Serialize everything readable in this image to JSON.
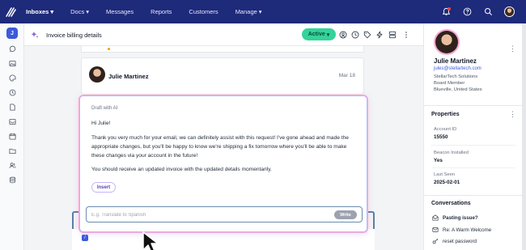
{
  "nav": {
    "items": [
      {
        "label": "Inboxes",
        "caret": true,
        "active": true
      },
      {
        "label": "Docs",
        "caret": true
      },
      {
        "label": "Messages",
        "caret": false
      },
      {
        "label": "Reports",
        "caret": false
      },
      {
        "label": "Customers",
        "caret": false
      },
      {
        "label": "Manage",
        "caret": true
      }
    ],
    "right_icons": [
      "notifications-icon",
      "help-icon",
      "search-icon",
      "user-avatar"
    ]
  },
  "leftbar": {
    "avatar_letter": "J",
    "icons": [
      "chat-icon",
      "image-icon",
      "palette-icon",
      "clock-icon",
      "document-icon",
      "inbox-icon",
      "calendar-icon",
      "folder-icon",
      "users-icon",
      "database-icon"
    ]
  },
  "header": {
    "title": "Invoice billing details",
    "status_label": "Active",
    "icons": [
      "assign-icon",
      "clock-icon",
      "tag-icon",
      "lightning-icon",
      "layout-icon",
      "more-icon"
    ]
  },
  "message": {
    "sender": "Julie Martinez",
    "date": "Mar 18"
  },
  "draft": {
    "label": "Draft with AI",
    "greeting": "Hi Julie!",
    "body": "Thank you very much for your email, we can definitely assist with this request! I've gone ahead and made the appropriate changes, but you'll be happy to know we're shipping a fix tomorrow where you'll be able to make these changes via your account in the future!",
    "closing": "You should receive an updated invoice with the updated details momentarily.",
    "insert_label": "Insert",
    "prompt_placeholder": "E.g. Translate to Spanish",
    "write_label": "Write"
  },
  "customer": {
    "name": "Julie Martinez",
    "email": "jules@stellartech.com",
    "company": "StellarTech Solutions",
    "role": "Board Member",
    "location": "Blueville, United States"
  },
  "properties": {
    "title": "Properties",
    "items": [
      {
        "label": "Account ID",
        "value": "15550"
      },
      {
        "label": "Beacon Installed",
        "value": "Yes"
      },
      {
        "label": "Last Seen",
        "value": "2025-02-01"
      }
    ]
  },
  "conversations": {
    "title": "Conversations",
    "items": [
      {
        "icon": "mail-open-icon",
        "label": "Pasting issue?",
        "bold": true
      },
      {
        "icon": "mail-icon",
        "label": "Re: A Warm Welcome",
        "bold": false
      },
      {
        "icon": "key-icon",
        "label": "reset password",
        "bold": false
      }
    ]
  },
  "colors": {
    "nav_bg": "#1e2a7a",
    "accent": "#3b5bdb",
    "active_status": "#34d399",
    "ai_border": "#c4b5fd"
  }
}
